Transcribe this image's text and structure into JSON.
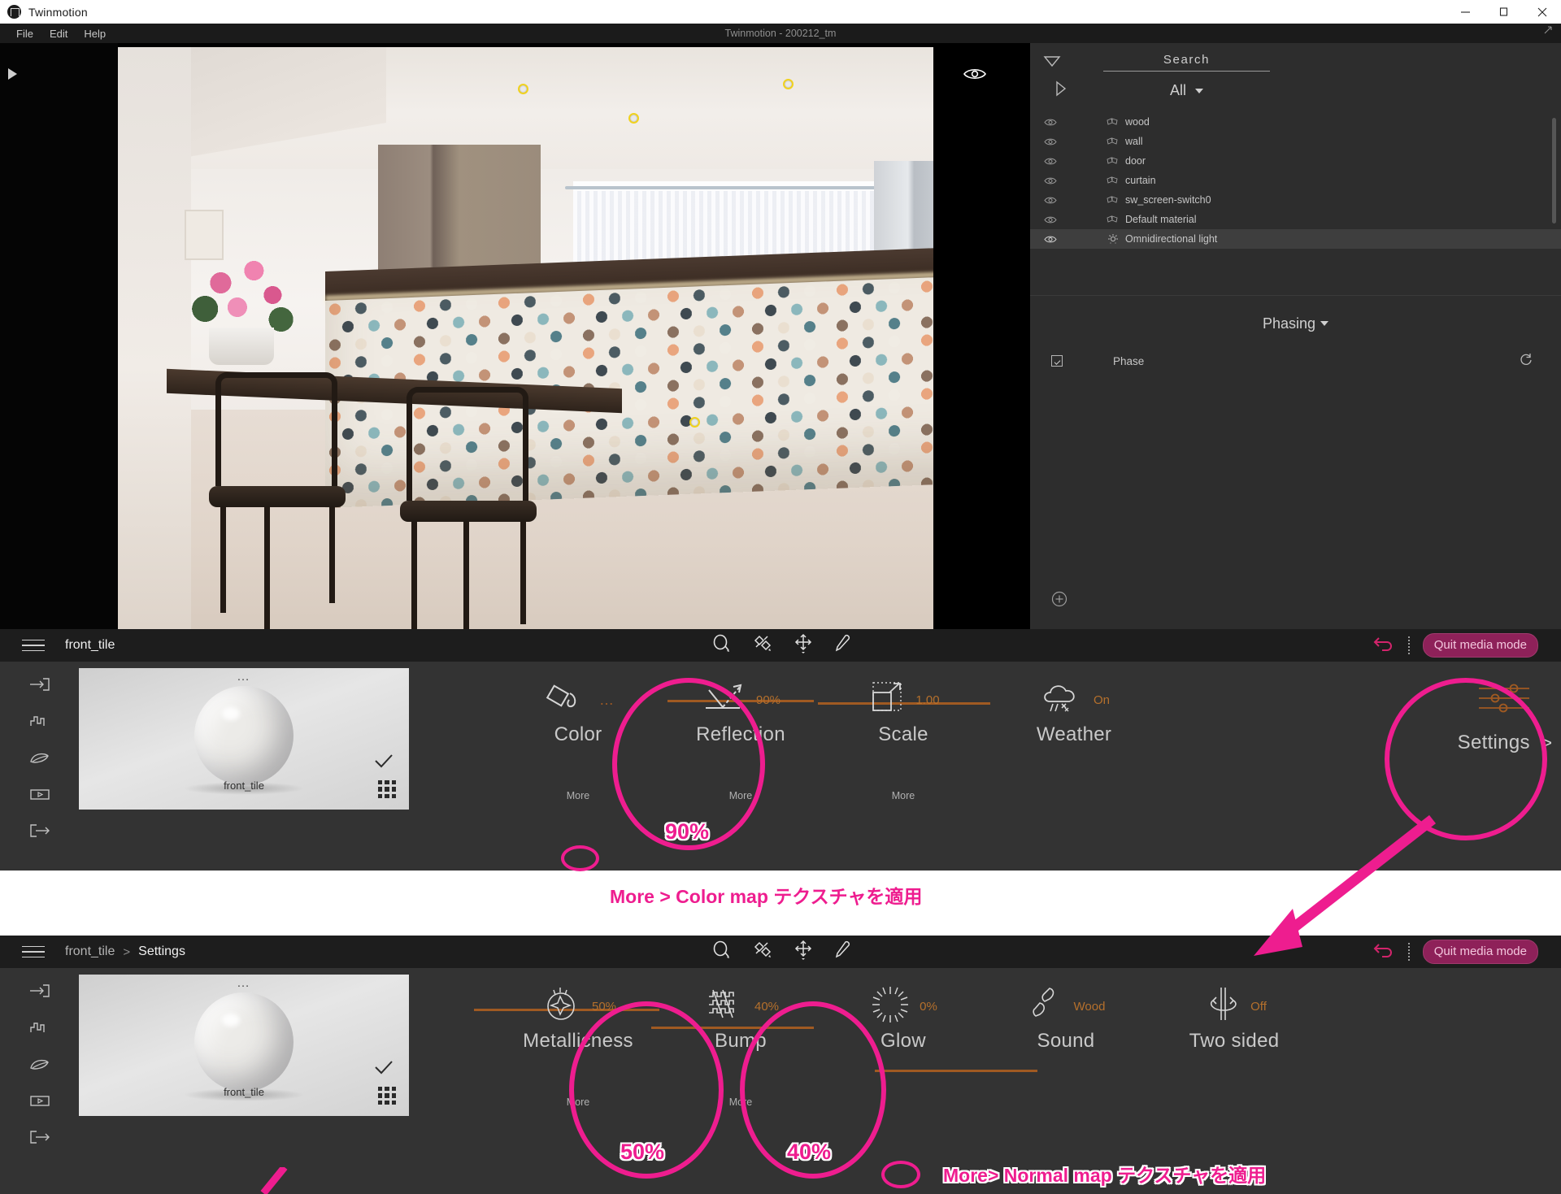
{
  "window": {
    "app_title": "Twinmotion",
    "project_title": "Twinmotion - 200212_tm",
    "minimize": "–",
    "maximize": "□",
    "close": "✕",
    "resize_icon": "resize-icon"
  },
  "menu": {
    "items": [
      "File",
      "Edit",
      "Help"
    ]
  },
  "viewport": {
    "visibility_icon": "eye-icon",
    "play_icon": "play-icon"
  },
  "right_dock": {
    "collapse_icon": "triangle-right-icon",
    "search": {
      "label": "Search",
      "placeholder": "Search"
    },
    "filter": {
      "selected": "All"
    },
    "objects": [
      {
        "name": "wood",
        "icon": "material-icon",
        "visible": true,
        "selected": false
      },
      {
        "name": "wall",
        "icon": "material-icon",
        "visible": true,
        "selected": false
      },
      {
        "name": "door",
        "icon": "material-icon",
        "visible": true,
        "selected": false
      },
      {
        "name": "curtain",
        "icon": "material-icon",
        "visible": true,
        "selected": false
      },
      {
        "name": "sw_screen-switch0",
        "icon": "material-icon",
        "visible": true,
        "selected": false
      },
      {
        "name": "Default material",
        "icon": "material-icon",
        "visible": true,
        "selected": false
      },
      {
        "name": "Omnidirectional light",
        "icon": "light-icon",
        "visible": true,
        "selected": true
      }
    ],
    "phasing": {
      "title": "Phasing",
      "phase_label": "Phase",
      "phase_checked": true,
      "refresh_icon": "refresh-icon",
      "add_icon": "plus-circle-icon"
    }
  },
  "panel_top": {
    "menu_icon": "hamburger-icon",
    "breadcrumb": [
      "front_tile"
    ],
    "tools": [
      "lasso-select-icon",
      "scatter-icon",
      "move-icon",
      "eyedropper-icon"
    ],
    "undo_icon": "undo-icon",
    "quit_label": "Quit media mode",
    "sidebar_icons": [
      "import-icon",
      "graph-icon",
      "leaf-icon",
      "video-icon",
      "export-icon"
    ],
    "thumbnail": {
      "name": "front_tile",
      "check_icon": "check-icon",
      "grid_icon": "grid-icon",
      "more_dots": "…"
    },
    "properties": [
      {
        "name": "Color",
        "value": "",
        "icon": "paint-bucket-icon",
        "more": "More",
        "slider_fill": 0
      },
      {
        "name": "Reflection",
        "value": "90%",
        "icon": "reflection-icon",
        "more": "More",
        "slider_fill": 90
      },
      {
        "name": "Scale",
        "value": "1.00",
        "icon": "scale-icon",
        "more": "More",
        "slider_fill": 50
      },
      {
        "name": "Weather",
        "value": "On",
        "icon": "weather-cloud-icon",
        "more": "",
        "slider_fill": 0
      },
      {
        "name": "Settings",
        "value": "",
        "icon": "sliders-icon",
        "more": "",
        "chevron": ">",
        "slider_fill": 0
      }
    ]
  },
  "panel_bottom": {
    "menu_icon": "hamburger-icon",
    "breadcrumb": [
      "front_tile",
      "Settings"
    ],
    "breadcrumb_sep": ">",
    "tools": [
      "lasso-select-icon",
      "scatter-icon",
      "move-icon",
      "eyedropper-icon"
    ],
    "undo_icon": "undo-icon",
    "quit_label": "Quit media mode",
    "sidebar_icons": [
      "import-icon",
      "graph-icon",
      "leaf-icon",
      "video-icon",
      "export-icon"
    ],
    "thumbnail": {
      "name": "front_tile",
      "check_icon": "check-icon",
      "grid_icon": "grid-icon",
      "more_dots": "…"
    },
    "properties": [
      {
        "name": "Metallicness",
        "value": "50%",
        "icon": "sparkle-circle-icon",
        "more": "More",
        "slider_fill": 50
      },
      {
        "name": "Bump",
        "value": "40%",
        "icon": "bump-wave-icon",
        "more": "More",
        "slider_fill": 40
      },
      {
        "name": "Glow",
        "value": "0%",
        "icon": "sun-rays-icon",
        "more": "",
        "slider_fill": 0
      },
      {
        "name": "Sound",
        "value": "Wood",
        "icon": "footsteps-icon",
        "more": "",
        "slider_fill": 0
      },
      {
        "name": "Two sided",
        "value": "Off",
        "icon": "two-sided-icon",
        "more": "",
        "slider_fill": 0
      }
    ]
  },
  "annotations": {
    "reflection_value": "90%",
    "metallicness_value": "50%",
    "bump_value": "40%",
    "note_color_map": "More > Color map テクスチャを適用",
    "note_normal_map": "More> Normal map テクスチャを適用"
  },
  "colors": {
    "accent_pink": "#ee1d8f",
    "slider_orange": "#a05a22",
    "value_orange": "#b5702c",
    "panel_bg": "#333333",
    "toolbar_bg": "#1d1d1d",
    "dock_bg": "#2d2d2d"
  }
}
